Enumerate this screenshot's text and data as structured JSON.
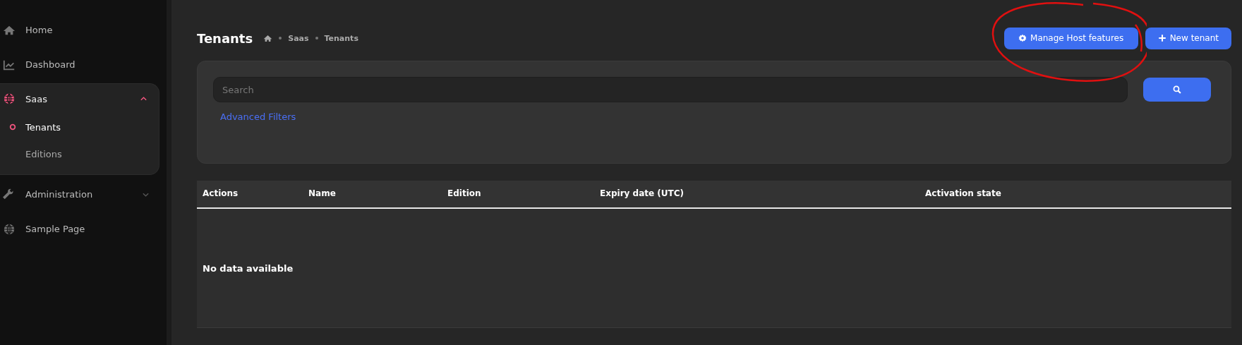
{
  "sidebar": {
    "items": [
      {
        "label": "Home",
        "selected": false
      },
      {
        "label": "Dashboard",
        "selected": false
      },
      {
        "label": "Saas",
        "selected": true,
        "expanded": true,
        "children": [
          {
            "label": "Tenants",
            "selected": true
          },
          {
            "label": "Editions",
            "selected": false
          }
        ]
      },
      {
        "label": "Administration",
        "selected": false,
        "expanded": false
      },
      {
        "label": "Sample Page",
        "selected": false
      }
    ]
  },
  "page": {
    "title": "Tenants",
    "breadcrumb": [
      "Saas",
      "Tenants"
    ]
  },
  "actions": [
    {
      "label": "Manage Host features"
    },
    {
      "label": "New tenant"
    }
  ],
  "filter": {
    "search": {
      "placeholder": "Search"
    },
    "advanced_link": "Advanced Filters"
  },
  "table": {
    "columns": [
      "Actions",
      "Name",
      "Edition",
      "Expiry date (UTC)",
      "Activation state"
    ],
    "empty_text": "No data available"
  }
}
